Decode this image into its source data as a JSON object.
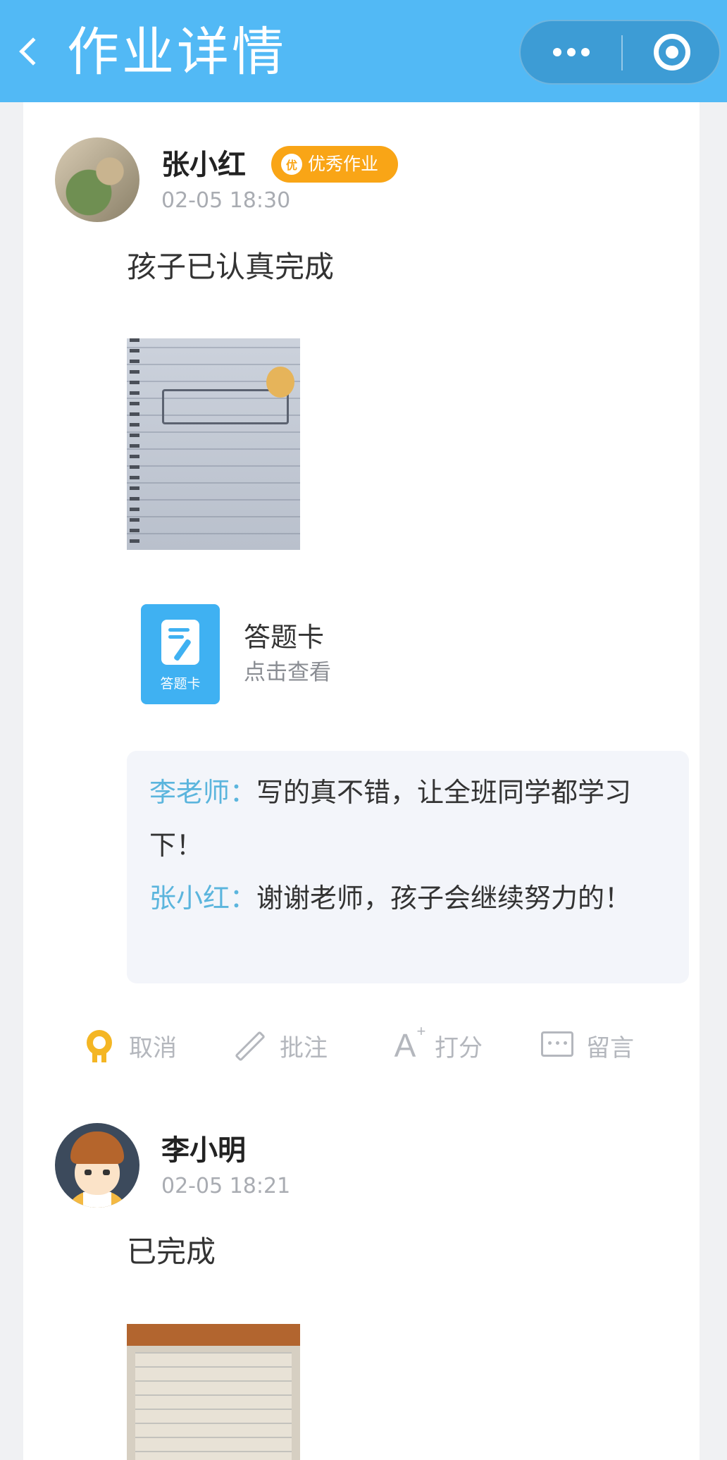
{
  "header": {
    "title": "作业详情",
    "back_icon": "chevron-left-icon",
    "more_icon": "more-dots-icon",
    "close_icon": "target-close-icon",
    "color": "#52b9f5"
  },
  "posts": [
    {
      "user": "张小红",
      "time": "02-05 18:30",
      "badge": {
        "icon_text": "优",
        "label": "优秀作业",
        "color": "#f9a516"
      },
      "text": "孩子已认真完成",
      "photo": "homework-notebook-photo",
      "answer_card": {
        "icon_label": "答题卡",
        "title": "答题卡",
        "subtitle": "点击查看"
      },
      "comments": [
        {
          "author": "李老师：",
          "text": "写的真不错，让全班同学都学习下！"
        },
        {
          "author": "张小红：",
          "text": "谢谢老师，孩子会继续努力的！"
        }
      ],
      "actions": [
        {
          "icon": "medal-icon",
          "label": "取消"
        },
        {
          "icon": "pencil-icon",
          "label": "批注"
        },
        {
          "icon": "score-icon",
          "label": "打分"
        },
        {
          "icon": "comment-icon",
          "label": "留言"
        }
      ]
    },
    {
      "user": "李小明",
      "time": "02-05 18:21",
      "text": "已完成",
      "photo": "homework-book-photo"
    }
  ],
  "colors": {
    "comment_author": "#5bb5dd",
    "badge": "#f9a516",
    "card_blue": "#3fb1f2"
  }
}
